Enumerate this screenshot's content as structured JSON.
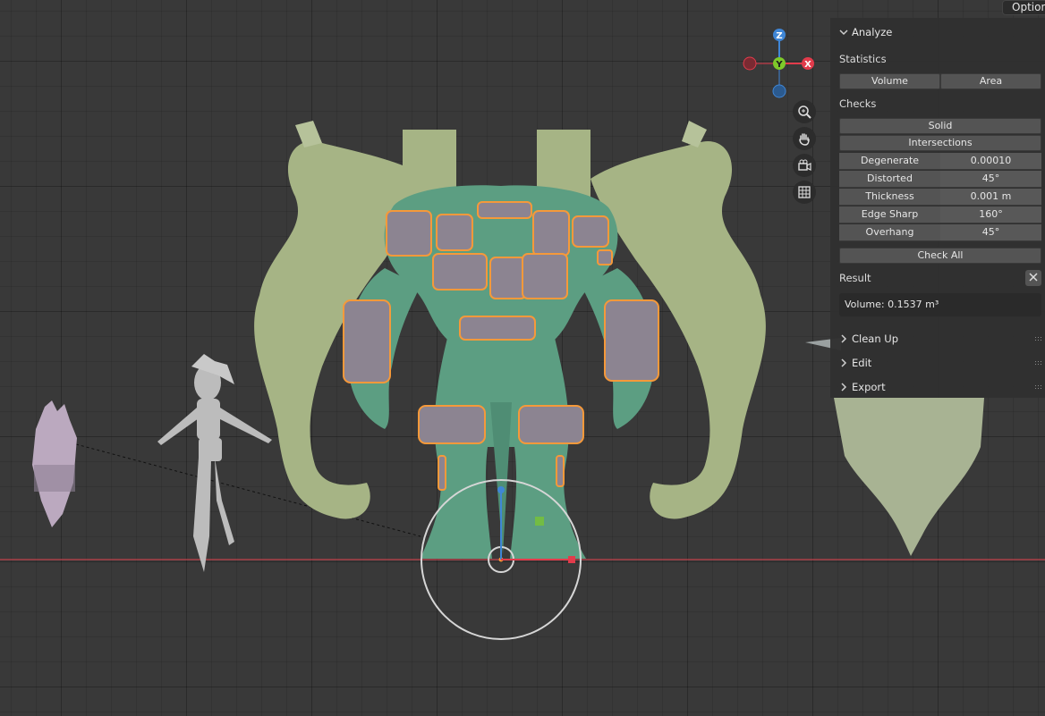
{
  "header": {
    "options_label": "Options"
  },
  "gizmo": {
    "x_label": "X",
    "y_label": "Y",
    "z_label": "Z"
  },
  "colors": {
    "x_axis": "#e23b4b",
    "y_axis": "#7ec92a",
    "z_axis": "#3f86d6",
    "monster_body": "#5c9e82",
    "monster_arms": "#a6b485",
    "selection_outline": "#f5993a",
    "panel_bg": "#303030",
    "button_bg": "#545454"
  },
  "nav_icons": [
    "zoom-icon",
    "hand-pan-icon",
    "camera-icon",
    "grid-icon"
  ],
  "panel": {
    "title": "Analyze",
    "statistics_label": "Statistics",
    "volume_button": "Volume",
    "area_button": "Area",
    "checks_label": "Checks",
    "solid_button": "Solid",
    "intersections_button": "Intersections",
    "checks": [
      {
        "label": "Degenerate",
        "value": "0.00010"
      },
      {
        "label": "Distorted",
        "value": "45°"
      },
      {
        "label": "Thickness",
        "value": "0.001 m"
      },
      {
        "label": "Edge Sharp",
        "value": "160°"
      },
      {
        "label": "Overhang",
        "value": "45°"
      }
    ],
    "check_all_button": "Check All",
    "result_label": "Result",
    "result_value": "Volume: 0.1537 m³",
    "sections": [
      "Clean Up",
      "Edit",
      "Export"
    ]
  }
}
